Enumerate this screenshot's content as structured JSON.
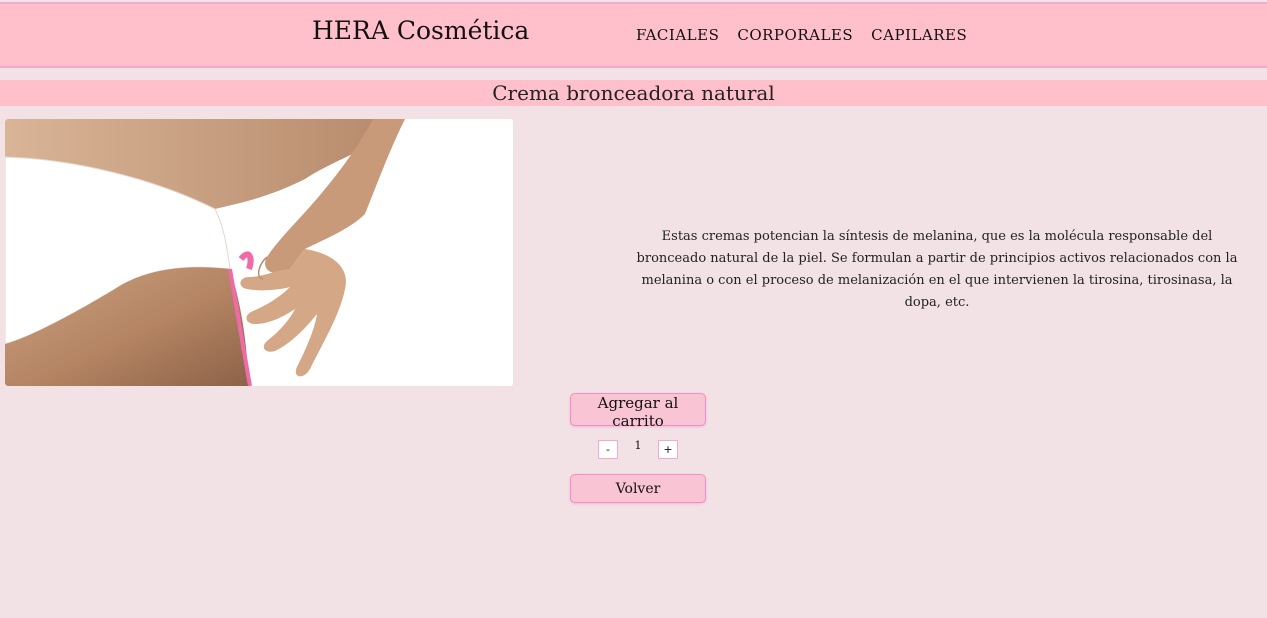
{
  "header": {
    "brand": "HERA Cosmética",
    "nav": [
      "FACIALES",
      "CORPORALES",
      "CAPILARES"
    ]
  },
  "product": {
    "title": "Crema bronceadora natural",
    "image_description": "product-photo-tan-lines",
    "description": "Estas cremas potencian la síntesis de melanina, que es la molécula responsable del bronceado natural de la piel. Se formulan a partir de principios activos relacionados con la melanina o con el proceso de melanización en el que intervienen la tirosina, tirosinasa, la dopa, etc."
  },
  "actions": {
    "add_to_cart": "Agregar al carrito",
    "minus": "-",
    "quantity": "1",
    "plus": "+",
    "back": "Volver"
  },
  "colors": {
    "background": "#f2e1e5",
    "header": "#ffc0cb",
    "border_accent": "#f08fc8",
    "button": "#f9c4d3"
  }
}
